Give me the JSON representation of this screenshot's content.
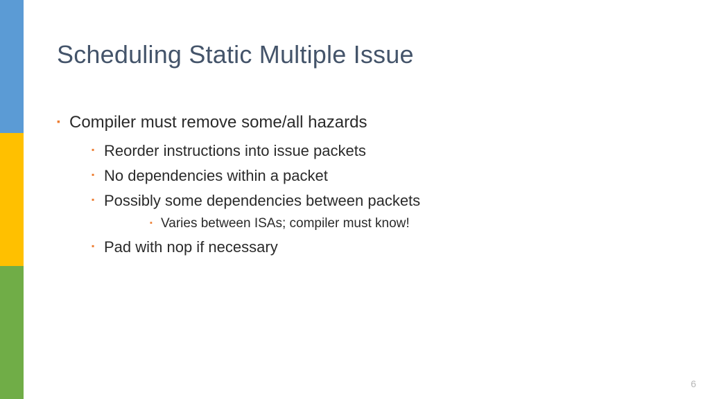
{
  "title": "Scheduling Static Multiple Issue",
  "bullets": {
    "b1": "Compiler must remove some/all hazards",
    "b1_1": "Reorder instructions into issue packets",
    "b1_2": "No dependencies within a packet",
    "b1_3": "Possibly some dependencies between packets",
    "b1_3_1": "Varies between ISAs; compiler must know!",
    "b1_4": "Pad with nop if necessary"
  },
  "page_number": "6"
}
